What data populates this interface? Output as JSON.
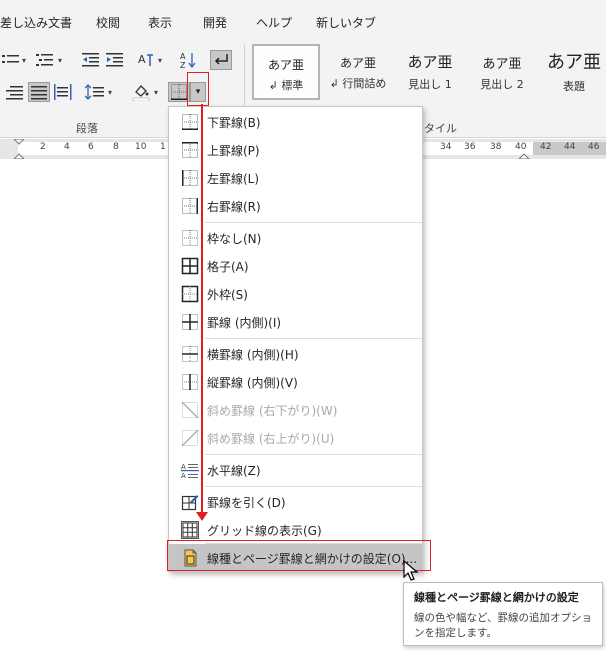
{
  "menubar": {
    "tabs": [
      "差し込み文書",
      "校閲",
      "表示",
      "開発",
      "ヘルプ",
      "新しいタブ"
    ]
  },
  "ribbon": {
    "paragraph_group_label": "段落",
    "styles_group_label": "タイル",
    "styles": [
      {
        "sample": "あア亜",
        "name": "↲ 標準"
      },
      {
        "sample": "あア亜",
        "name": "↲ 行間詰め"
      },
      {
        "sample": "あア亜",
        "name": "見出し 1"
      },
      {
        "sample": "あア亜",
        "name": "見出し 2"
      },
      {
        "sample": "あア亜",
        "name": "表題"
      }
    ]
  },
  "ruler": {
    "left_numbers": [
      "2",
      "4",
      "6",
      "8",
      "10",
      "1"
    ],
    "right_numbers": [
      "34",
      "36",
      "38",
      "40",
      "42",
      "44",
      "46"
    ]
  },
  "dropdown": {
    "items": [
      {
        "label": "下罫線(B)",
        "icon": "border-bottom-icon",
        "disabled": false
      },
      {
        "label": "上罫線(P)",
        "icon": "border-top-icon",
        "disabled": false
      },
      {
        "label": "左罫線(L)",
        "icon": "border-left-icon",
        "disabled": false
      },
      {
        "label": "右罫線(R)",
        "icon": "border-right-icon",
        "disabled": false
      },
      {
        "label": "枠なし(N)",
        "icon": "no-border-icon",
        "disabled": false
      },
      {
        "label": "格子(A)",
        "icon": "all-borders-icon",
        "disabled": false
      },
      {
        "label": "外枠(S)",
        "icon": "outside-borders-icon",
        "disabled": false
      },
      {
        "label": "罫線 (内側)(I)",
        "icon": "inside-borders-icon",
        "disabled": false
      },
      {
        "label": "横罫線 (内側)(H)",
        "icon": "inside-horizontal-border-icon",
        "disabled": false
      },
      {
        "label": "縦罫線 (内側)(V)",
        "icon": "inside-vertical-border-icon",
        "disabled": false
      },
      {
        "label": "斜め罫線 (右下がり)(W)",
        "icon": "diagonal-down-border-icon",
        "disabled": true
      },
      {
        "label": "斜め罫線 (右上がり)(U)",
        "icon": "diagonal-up-border-icon",
        "disabled": true
      },
      {
        "label": "水平線(Z)",
        "icon": "horizontal-line-icon",
        "disabled": false
      },
      {
        "label": "罫線を引く(D)",
        "icon": "draw-table-icon",
        "disabled": false
      },
      {
        "label": "グリッド線の表示(G)",
        "icon": "view-gridlines-icon",
        "disabled": false
      },
      {
        "label": "線種とページ罫線と網かけの設定(O)...",
        "icon": "borders-shading-icon",
        "disabled": false
      }
    ]
  },
  "tooltip": {
    "title": "線種とページ罫線と網かけの設定",
    "description": "線の色や幅など、罫線の追加オプションを指定します。"
  },
  "colors": {
    "highlight": "#c5c5c5",
    "annotation_red": "#e02020",
    "ribbon_bg": "#f3f3f3"
  }
}
